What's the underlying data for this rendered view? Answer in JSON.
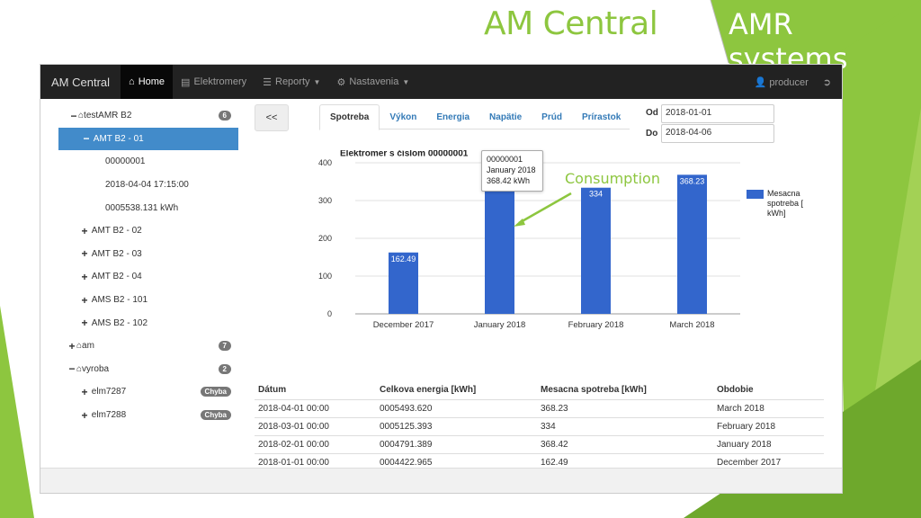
{
  "slide": {
    "title": "AM Central",
    "tag": "AMR systems",
    "annotation": "Consumption"
  },
  "colors": {
    "accent_green": "#8dc63f",
    "bar_blue": "#3366cc",
    "navbar": "#222222",
    "selected": "#428bca"
  },
  "navbar": {
    "brand": "AM Central",
    "items": [
      {
        "label": "Home",
        "icon": "home-icon",
        "active": true
      },
      {
        "label": "Elektromery",
        "icon": "meter-icon"
      },
      {
        "label": "Reporty",
        "icon": "list-icon",
        "caret": true
      },
      {
        "label": "Nastavenia",
        "icon": "gear-icon",
        "caret": true
      }
    ],
    "user": "producer"
  },
  "sidebar": {
    "testamr": {
      "label": "testAMR B2",
      "badge": "6"
    },
    "amt01": {
      "label": "AMT B2 - 01"
    },
    "leaves": [
      "00000001",
      "2018-04-04 17:15:00",
      "0005538.131 kWh"
    ],
    "amt_items": [
      "AMT B2 - 02",
      "AMT B2 - 03",
      "AMT B2 - 04",
      "AMS B2 - 101",
      "AMS B2 - 102"
    ],
    "am": {
      "label": "am",
      "badge": "7"
    },
    "vyroba": {
      "label": "vyroba",
      "badge": "2"
    },
    "elm": [
      {
        "label": "elm7287",
        "badge": "Chyba"
      },
      {
        "label": "elm7288",
        "badge": "Chyba"
      }
    ]
  },
  "back_label": "<<",
  "tabs": [
    "Spotreba",
    "Výkon",
    "Energia",
    "Napätie",
    "Prúd",
    "Prírastok"
  ],
  "dates": {
    "od_label": "Od",
    "od": "2018-01-01",
    "do_label": "Do",
    "do": "2018-04-06"
  },
  "tooltip": {
    "line1": "00000001",
    "line2": "January 2018",
    "line3": "368.42 kWh"
  },
  "chart_data": {
    "type": "bar",
    "title": "Elektromer s číslom 00000001",
    "categories": [
      "December 2017",
      "January 2018",
      "February 2018",
      "March 2018"
    ],
    "series": [
      {
        "name": "Mesacna spotreba [ kWh]",
        "values": [
          162.49,
          368.42,
          334,
          368.23
        ]
      }
    ],
    "data_labels": [
      "162.49",
      "368.42",
      "334",
      "368.23"
    ],
    "ylim": [
      0,
      400
    ],
    "yticks": [
      0,
      100,
      200,
      300,
      400
    ],
    "grid": true,
    "legend": "right"
  },
  "table": {
    "headers": [
      "Dátum",
      "Celkova energia [kWh]",
      "Mesacna spotreba [kWh]",
      "Obdobie"
    ],
    "rows": [
      [
        "2018-04-01 00:00",
        "0005493.620",
        "368.23",
        "March 2018"
      ],
      [
        "2018-03-01 00:00",
        "0005125.393",
        "334",
        "February 2018"
      ],
      [
        "2018-02-01 00:00",
        "0004791.389",
        "368.42",
        "January 2018"
      ],
      [
        "2018-01-01 00:00",
        "0004422.965",
        "162.49",
        "December 2017"
      ]
    ]
  }
}
